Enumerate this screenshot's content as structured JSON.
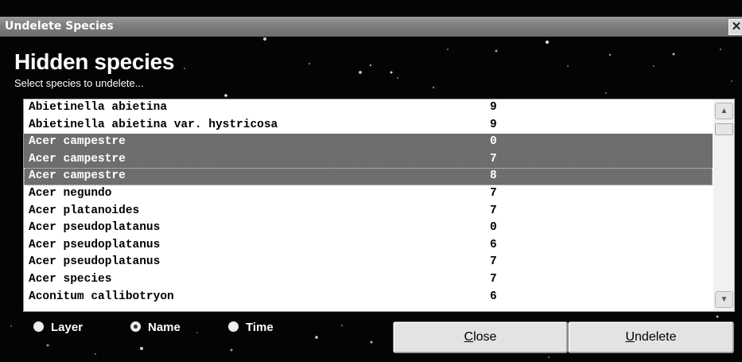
{
  "window": {
    "title": "Undelete Species",
    "close_glyph": "✕"
  },
  "header": {
    "heading": "Hidden species",
    "subheading": "Select species to undelete..."
  },
  "list": {
    "rows": [
      {
        "name": "Abietinella abietina",
        "value": "9",
        "selected": false
      },
      {
        "name": "Abietinella abietina var. hystricosa",
        "value": "9",
        "selected": false
      },
      {
        "name": "Acer campestre",
        "value": "0",
        "selected": true
      },
      {
        "name": "Acer campestre",
        "value": "7",
        "selected": true
      },
      {
        "name": "Acer campestre",
        "value": "8",
        "selected": true,
        "focused": true
      },
      {
        "name": "Acer negundo",
        "value": "7",
        "selected": false
      },
      {
        "name": "Acer platanoides",
        "value": "7",
        "selected": false
      },
      {
        "name": "Acer pseudoplatanus",
        "value": "0",
        "selected": false
      },
      {
        "name": "Acer pseudoplatanus",
        "value": "6",
        "selected": false
      },
      {
        "name": "Acer pseudoplatanus",
        "value": "7",
        "selected": false
      },
      {
        "name": "Acer species",
        "value": "7",
        "selected": false
      },
      {
        "name": "Aconitum callibotryon",
        "value": "6",
        "selected": false
      }
    ]
  },
  "sort_options": {
    "selected": "Name",
    "items": [
      {
        "label": "Layer"
      },
      {
        "label": "Name"
      },
      {
        "label": "Time"
      }
    ]
  },
  "buttons": {
    "close": {
      "accel": "C",
      "rest": "lose"
    },
    "undelete": {
      "accel": "U",
      "rest": "ndelete"
    }
  },
  "icons": {
    "scroll_up": "chevron-up-icon",
    "scroll_down": "chevron-down-icon"
  }
}
